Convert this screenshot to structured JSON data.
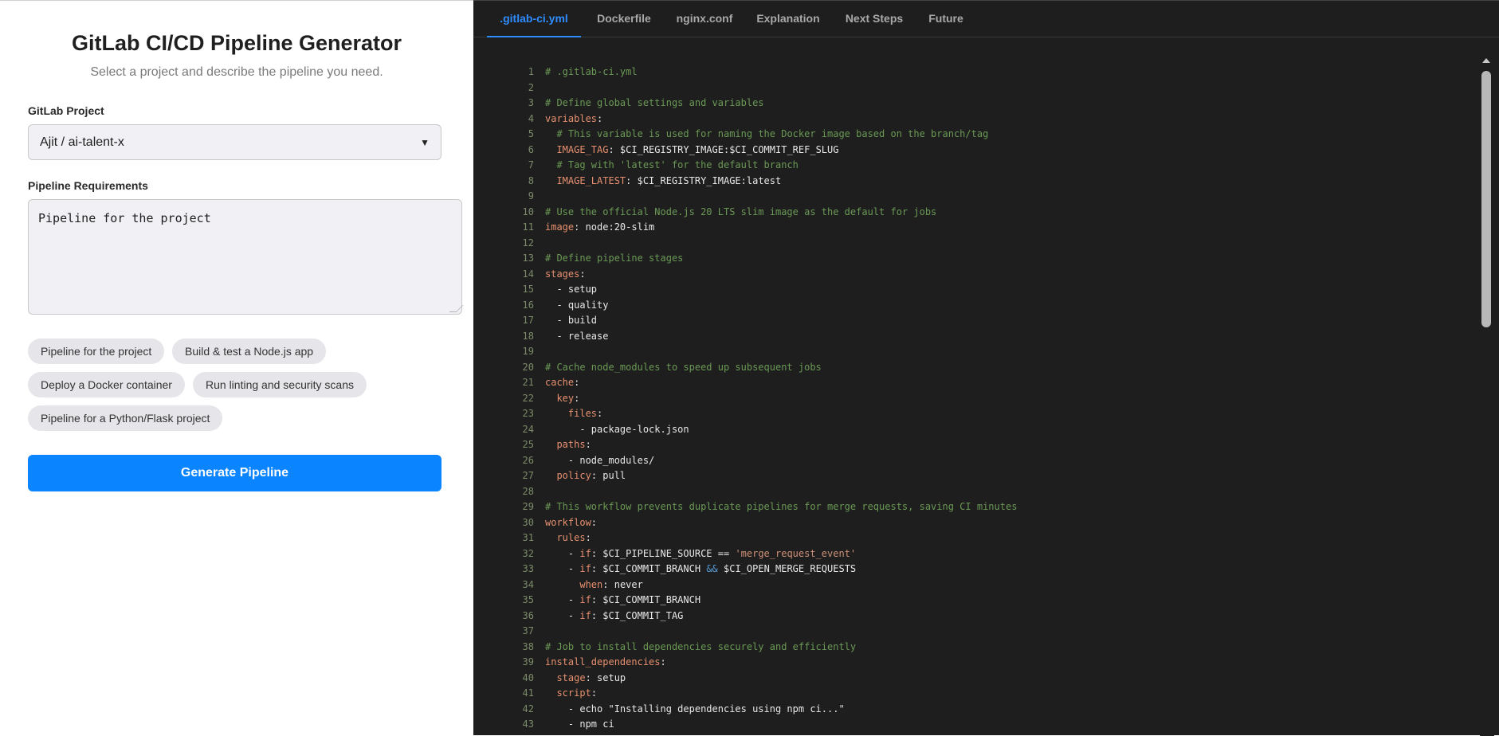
{
  "app": {
    "title": "GitLab CI/CD Pipeline Generator",
    "subtitle": "Select a project and describe the pipeline you need."
  },
  "form": {
    "project_label": "GitLab Project",
    "project_value": "Ajit / ai-talent-x",
    "requirements_label": "Pipeline Requirements",
    "requirements_value": "Pipeline for the project",
    "suggestions": [
      "Pipeline for the project",
      "Build & test a Node.js app",
      "Deploy a Docker container",
      "Run linting and security scans",
      "Pipeline for a Python/Flask project"
    ],
    "generate_label": "Generate Pipeline"
  },
  "tabs": [
    {
      "label": ".gitlab-ci.yml",
      "active": true
    },
    {
      "label": "Dockerfile",
      "active": false
    },
    {
      "label": "nginx.conf",
      "active": false
    },
    {
      "label": "Explanation",
      "active": false
    },
    {
      "label": "Next Steps",
      "active": false
    },
    {
      "label": "Future",
      "active": false
    }
  ],
  "code_lines": [
    [
      [
        "c",
        "# .gitlab-ci.yml"
      ]
    ],
    [],
    [
      [
        "c",
        "# Define global settings and variables"
      ]
    ],
    [
      [
        "k",
        "variables"
      ],
      [
        "v",
        ":"
      ]
    ],
    [
      [
        "v",
        "  "
      ],
      [
        "c",
        "# This variable is used for naming the Docker image based on the branch/tag"
      ]
    ],
    [
      [
        "v",
        "  "
      ],
      [
        "k",
        "IMAGE_TAG"
      ],
      [
        "v",
        ": $CI_REGISTRY_IMAGE:$CI_COMMIT_REF_SLUG"
      ]
    ],
    [
      [
        "v",
        "  "
      ],
      [
        "c",
        "# Tag with 'latest' for the default branch"
      ]
    ],
    [
      [
        "v",
        "  "
      ],
      [
        "k",
        "IMAGE_LATEST"
      ],
      [
        "v",
        ": $CI_REGISTRY_IMAGE:latest"
      ]
    ],
    [],
    [
      [
        "c",
        "# Use the official Node.js 20 LTS slim image as the default for jobs"
      ]
    ],
    [
      [
        "k",
        "image"
      ],
      [
        "v",
        ": node:20-slim"
      ]
    ],
    [],
    [
      [
        "c",
        "# Define pipeline stages"
      ]
    ],
    [
      [
        "k",
        "stages"
      ],
      [
        "v",
        ":"
      ]
    ],
    [
      [
        "v",
        "  - setup"
      ]
    ],
    [
      [
        "v",
        "  - quality"
      ]
    ],
    [
      [
        "v",
        "  - build"
      ]
    ],
    [
      [
        "v",
        "  - release"
      ]
    ],
    [],
    [
      [
        "c",
        "# Cache node_modules to speed up subsequent jobs"
      ]
    ],
    [
      [
        "k",
        "cache"
      ],
      [
        "v",
        ":"
      ]
    ],
    [
      [
        "v",
        "  "
      ],
      [
        "k",
        "key"
      ],
      [
        "v",
        ":"
      ]
    ],
    [
      [
        "v",
        "    "
      ],
      [
        "k",
        "files"
      ],
      [
        "v",
        ":"
      ]
    ],
    [
      [
        "v",
        "      - package-lock.json"
      ]
    ],
    [
      [
        "v",
        "  "
      ],
      [
        "k",
        "paths"
      ],
      [
        "v",
        ":"
      ]
    ],
    [
      [
        "v",
        "    - node_modules/"
      ]
    ],
    [
      [
        "v",
        "  "
      ],
      [
        "k",
        "policy"
      ],
      [
        "v",
        ": pull"
      ]
    ],
    [],
    [
      [
        "c",
        "# This workflow prevents duplicate pipelines for merge requests, saving CI minutes"
      ]
    ],
    [
      [
        "k",
        "workflow"
      ],
      [
        "v",
        ":"
      ]
    ],
    [
      [
        "v",
        "  "
      ],
      [
        "k",
        "rules"
      ],
      [
        "v",
        ":"
      ]
    ],
    [
      [
        "v",
        "    - "
      ],
      [
        "k",
        "if"
      ],
      [
        "v",
        ": $CI_PIPELINE_SOURCE == "
      ],
      [
        "s",
        "'merge_request_event'"
      ]
    ],
    [
      [
        "v",
        "    - "
      ],
      [
        "k",
        "if"
      ],
      [
        "v",
        ": $CI_COMMIT_BRANCH "
      ],
      [
        "o",
        "&&"
      ],
      [
        "v",
        " $CI_OPEN_MERGE_REQUESTS"
      ]
    ],
    [
      [
        "v",
        "      "
      ],
      [
        "k",
        "when"
      ],
      [
        "v",
        ": never"
      ]
    ],
    [
      [
        "v",
        "    - "
      ],
      [
        "k",
        "if"
      ],
      [
        "v",
        ": $CI_COMMIT_BRANCH"
      ]
    ],
    [
      [
        "v",
        "    - "
      ],
      [
        "k",
        "if"
      ],
      [
        "v",
        ": $CI_COMMIT_TAG"
      ]
    ],
    [],
    [
      [
        "c",
        "# Job to install dependencies securely and efficiently"
      ]
    ],
    [
      [
        "k",
        "install_dependencies"
      ],
      [
        "v",
        ":"
      ]
    ],
    [
      [
        "v",
        "  "
      ],
      [
        "k",
        "stage"
      ],
      [
        "v",
        ": setup"
      ]
    ],
    [
      [
        "v",
        "  "
      ],
      [
        "k",
        "script"
      ],
      [
        "v",
        ":"
      ]
    ],
    [
      [
        "v",
        "    - echo \"Installing dependencies using npm ci...\""
      ]
    ],
    [
      [
        "v",
        "    - npm ci"
      ]
    ]
  ],
  "colors": {
    "accent": "#0a84ff",
    "tab_active": "#2f8cff",
    "editor_bg": "#1e1e1e",
    "comment": "#6a9955",
    "key": "#e7906f"
  }
}
